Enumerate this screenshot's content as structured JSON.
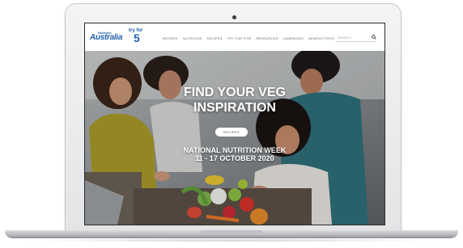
{
  "site": {
    "logo_small": "Nutrition",
    "logo_main": "Australia",
    "tryfor_small": "try for",
    "tryfor_number": "5",
    "nav": [
      "RECIPES",
      "NUTRITION",
      "RECIPES",
      "TRY FOR FIVE",
      "RESOURCES",
      "CAMPAIGNS",
      "NEWSLETTERS"
    ],
    "search_placeholder": "SEARCH"
  },
  "hero": {
    "title_line1": "FIND YOUR VEG",
    "title_line2": "INSPIRATION",
    "button_label": "RECIPES",
    "event_line1": "NATIONAL NUTRITION WEEK",
    "event_line2": "11 - 17 OCTOBER 2020"
  },
  "colors": {
    "brand_blue": "#1f5fa8",
    "laptop_silver": "#e3e4e6"
  }
}
